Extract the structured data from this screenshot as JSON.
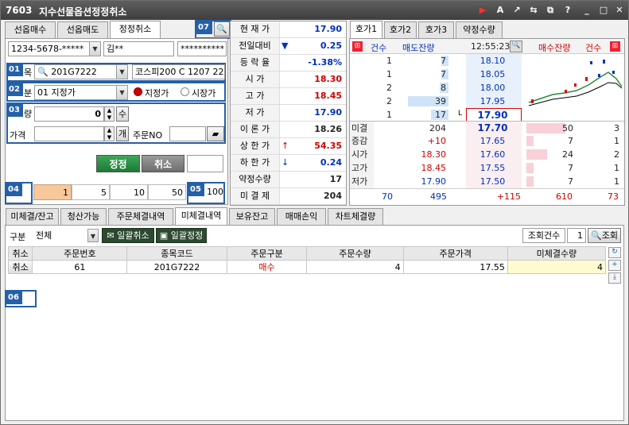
{
  "title": {
    "code": "7603",
    "name": "지수선물옵션정정취소"
  },
  "window_buttons": [
    "▶",
    "A",
    "↗",
    "⇆",
    "⧉",
    "?",
    "_",
    "□",
    "✕"
  ],
  "order_tabs": [
    "선옵매수",
    "선옵매도",
    "정정취소"
  ],
  "account": {
    "number": "1234-5678-*****",
    "holder": "김**",
    "password": "**********"
  },
  "badges": [
    "01",
    "02",
    "03",
    "04",
    "05",
    "06",
    "07"
  ],
  "item": {
    "label": "목",
    "code": "201G7222",
    "name": "코스피200 C 1207 222"
  },
  "type": {
    "label": "분",
    "value": "01 지정가",
    "opt1": "지정가",
    "opt2": "시장가"
  },
  "qty": {
    "label": "량",
    "value": "0",
    "spin": "수"
  },
  "price": {
    "label": "가격",
    "spin": "개",
    "orderno_label": "주문NO"
  },
  "actions": {
    "modify": "정정",
    "cancel": "취소"
  },
  "qty_presets": [
    "1",
    "5",
    "10",
    "50"
  ],
  "qty_preset_extra": "100",
  "quote": [
    {
      "label": "현 재 가",
      "value": "17.90",
      "color": "blue",
      "arrow": ""
    },
    {
      "label": "전일대비",
      "value": "0.25",
      "color": "blue",
      "arrow": "▼"
    },
    {
      "label": "등 락 율",
      "value": "-1.38%",
      "color": "blue",
      "arrow": ""
    },
    {
      "label": "시    가",
      "value": "18.30",
      "color": "red",
      "arrow": ""
    },
    {
      "label": "고    가",
      "value": "18.45",
      "color": "red",
      "arrow": ""
    },
    {
      "label": "저    가",
      "value": "17.90",
      "color": "blue",
      "arrow": ""
    },
    {
      "label": "이 론 가",
      "value": "18.26",
      "color": "dark",
      "arrow": ""
    },
    {
      "label": "상 한 가",
      "value": "54.35",
      "color": "red",
      "arrow": "↑"
    },
    {
      "label": "하 한 가",
      "value": "0.24",
      "color": "blue",
      "arrow": "↓"
    },
    {
      "label": "약정수량",
      "value": "17",
      "color": "dark",
      "arrow": ""
    },
    {
      "label": "미 결 제",
      "value": "204",
      "color": "dark",
      "arrow": ""
    }
  ],
  "hoga_tabs": [
    "호가1",
    "호가2",
    "호가3",
    "약정수량"
  ],
  "hoga_header": {
    "cnt": "건수",
    "sell": "매도잔량",
    "time": "12:55:23",
    "buy": "매수잔량",
    "cnt2": "건수"
  },
  "asks": [
    {
      "cnt": "1",
      "qty": "7",
      "price": "18.10",
      "bar": 0.15
    },
    {
      "cnt": "1",
      "qty": "7",
      "price": "18.05",
      "bar": 0.15
    },
    {
      "cnt": "2",
      "qty": "8",
      "price": "18.00",
      "bar": 0.18
    },
    {
      "cnt": "2",
      "qty": "39",
      "price": "17.95",
      "bar": 0.85
    },
    {
      "cnt": "1",
      "qty": "17",
      "price": "17.90",
      "bar": 0.37,
      "mark": "L"
    }
  ],
  "bids": [
    {
      "label": "미결",
      "left": "204",
      "price": "17.70",
      "qty": "50",
      "cnt": "3",
      "bar": 0.75,
      "lcolor": "dark",
      "pcolor": "blue"
    },
    {
      "label": "증감",
      "left": "+10",
      "price": "17.65",
      "qty": "7",
      "cnt": "1",
      "bar": 0.14,
      "lcolor": "red",
      "pcolor": "blue"
    },
    {
      "label": "시가",
      "left": "18.30",
      "price": "17.60",
      "qty": "24",
      "cnt": "2",
      "bar": 0.4,
      "lcolor": "red",
      "pcolor": "blue"
    },
    {
      "label": "고가",
      "left": "18.45",
      "price": "17.55",
      "qty": "7",
      "cnt": "1",
      "bar": 0.14,
      "lcolor": "red",
      "pcolor": "blue"
    },
    {
      "label": "저가",
      "left": "17.90",
      "price": "17.50",
      "qty": "7",
      "cnt": "1",
      "bar": 0.14,
      "lcolor": "blue",
      "pcolor": "blue"
    }
  ],
  "hoga_totals": {
    "cnt1": "70",
    "sell": "495",
    "diff": "+115",
    "buy": "610",
    "cnt2": "73"
  },
  "bottom_tabs": [
    "미체결/잔고",
    "청산가능",
    "주문체결내역",
    "미체결내역",
    "보유잔고",
    "매매손익",
    "차트체결량"
  ],
  "filter": {
    "label": "구분",
    "value": "전체",
    "cancel_all": "일괄취소",
    "modify_all": "일괄정정",
    "count_label": "조회건수",
    "count": "1",
    "search": "조회"
  },
  "table": {
    "headers": [
      "취소",
      "주문번호",
      "종목코드",
      "주문구분",
      "주문수량",
      "주문가격",
      "미체결수량"
    ],
    "rows": [
      {
        "cancel": "취소",
        "no": "61",
        "code": "201G7222",
        "side": "매수",
        "qty": "4",
        "price": "17.55",
        "unfilled": "4"
      }
    ]
  }
}
